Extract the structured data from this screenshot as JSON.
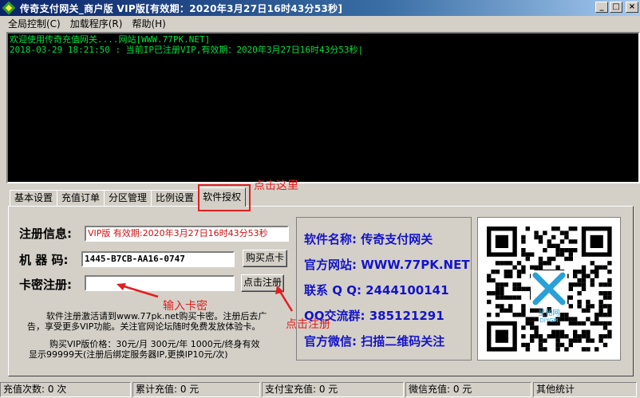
{
  "window": {
    "title": "传奇支付网关_商户版  VIP版[有效期：2020年3月27日16时43分53秒]",
    "minimize": "_",
    "maximize": "□",
    "close": "×"
  },
  "menu": {
    "items": [
      "全局控制(C)",
      "加载程序(R)",
      "帮助(H)"
    ]
  },
  "log": {
    "lines": [
      "欢迎使用传奇充值网关....网站[WWW.77PK.NET]",
      "2018-03-29 18:21:50 : 当前IP已注册VIP,有效期：2020年3月27日16时43分53秒|"
    ]
  },
  "tabs": {
    "items": [
      "基本设置",
      "充值订单",
      "分区管理",
      "比例设置",
      "软件授权"
    ],
    "active": "软件授权"
  },
  "annotations": {
    "click_here": "点击这里",
    "enter_card": "输入卡密",
    "click_register": "点击注册",
    "color": "#e01f1f"
  },
  "register": {
    "info_label": "注册信息:",
    "info_value": "VIP版 有效期:2020年3月27日16时43分53秒",
    "machine_label": "机 器 码:",
    "machine_value": "1445-B7CB-AA16-0747",
    "buy_button": "购买点卡",
    "card_label": "卡密注册:",
    "card_value": "",
    "register_button": "点击注册",
    "desc1": "软件注册激活请到www.77pk.net购买卡密。注册后去广",
    "desc2": "告，享受更多VIP功能。关注官网论坛随时免费发放体验卡。",
    "price1": "购买VIP版价格：30元/月   300元/年   1000元/终身有效",
    "price2": "显示99999天(注册后绑定服务器IP,更换IP10元/次)"
  },
  "info": {
    "lines": [
      "软件名称: 传奇支付网关",
      "官方网站: WWW.77PK.NET",
      "联系 Q Q: 2444100141",
      "QQ交流群: 385121291",
      "官方微信: 扫描二维码关注"
    ],
    "color": "#1414c8"
  },
  "qr": {
    "icon": "qr-code-icon",
    "logo_text": "星驰网",
    "logo_subtext": "DIYGM"
  },
  "status": {
    "cells": [
      "充值次数: 0 次",
      "累计充值: 0 元",
      "支付宝充值: 0 元",
      "微信充值: 0 元",
      "其他统计"
    ]
  }
}
